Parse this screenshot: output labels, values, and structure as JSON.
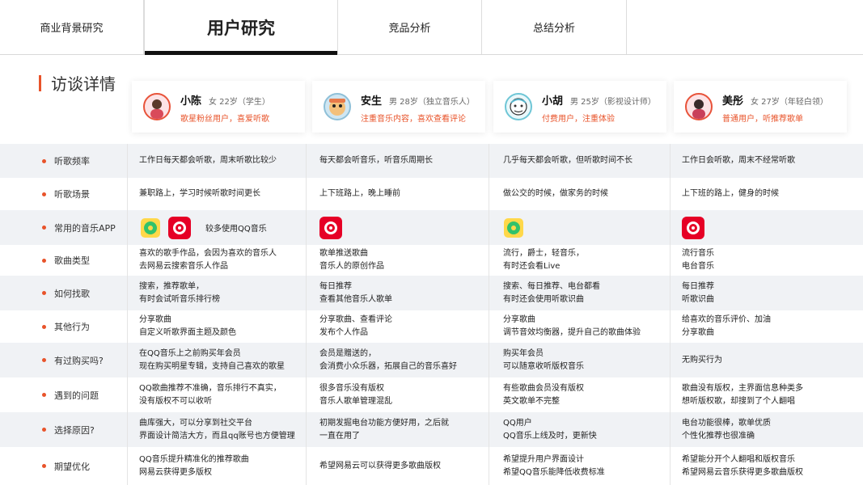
{
  "tabs": [
    {
      "label": "商业背景研究"
    },
    {
      "label": "用户研究"
    },
    {
      "label": "竞品分析"
    },
    {
      "label": "总结分析"
    }
  ],
  "section_title": "访谈详情",
  "users": [
    {
      "name": "小陈",
      "meta": "女 22岁（学生）",
      "tags": "歌星粉丝用户，喜爱听歌"
    },
    {
      "name": "安生",
      "meta": "男 28岁（独立音乐人）",
      "tags": "注重音乐内容，喜欢查看评论"
    },
    {
      "name": "小胡",
      "meta": "男 25岁（影视设计师）",
      "tags": "付费用户，注重体验"
    },
    {
      "name": "美彤",
      "meta": "女 27岁（年轻白领）",
      "tags": "普通用户，听推荐歌单"
    }
  ],
  "rows": [
    {
      "label": "听歌频率",
      "cells": [
        [
          "工作日每天都会听歌，周末听歌比较少"
        ],
        [
          "每天都会听音乐，听音乐周期长"
        ],
        [
          "几乎每天都会听歌，但听歌时间不长"
        ],
        [
          "工作日会听歌，周末不经常听歌"
        ]
      ]
    },
    {
      "label": "听歌场景",
      "cells": [
        [
          "兼职路上，学习时候听歌时间更长"
        ],
        [
          "上下班路上，晚上睡前"
        ],
        [
          "做公交的时候，做家务的时候"
        ],
        [
          "上下班的路上，健身的时候"
        ]
      ]
    },
    {
      "label": "常用的音乐APP",
      "app_note": "较多使用QQ音乐"
    },
    {
      "label": "歌曲类型",
      "cells": [
        [
          "喜欢的歌手作品，会因为喜欢的音乐人",
          "去网易云搜索音乐人作品"
        ],
        [
          "歌单推送歌曲",
          "音乐人的原创作品"
        ],
        [
          "流行，爵士，轻音乐，",
          "有时还会看Live"
        ],
        [
          "流行音乐",
          "电台音乐"
        ]
      ]
    },
    {
      "label": "如何找歌",
      "cells": [
        [
          "搜索，推荐歌单，",
          "有时会试听音乐排行榜"
        ],
        [
          "每日推荐",
          "查看其他音乐人歌单"
        ],
        [
          "搜索、每日推荐、电台都看",
          "有时还会使用听歌识曲"
        ],
        [
          "每日推荐",
          "听歌识曲"
        ]
      ]
    },
    {
      "label": "其他行为",
      "cells": [
        [
          "分享歌曲",
          "自定义听歌界面主题及颜色"
        ],
        [
          "分享歌曲、查看评论",
          "发布个人作品"
        ],
        [
          "分享歌曲",
          "调节音效均衡器，提升自己的歌曲体验"
        ],
        [
          "给喜欢的音乐评价、加油",
          "分享歌曲"
        ]
      ]
    },
    {
      "label": "有过购买吗?",
      "cells": [
        [
          "在QQ音乐上之前购买年会员",
          "现在购买明星专辑，支持自己喜欢的歌星"
        ],
        [
          "会员是赠送的，",
          "会消费小众乐器，拓展自己的音乐喜好"
        ],
        [
          "购买年会员",
          "可以随意收听版权音乐"
        ],
        [
          "无购买行为"
        ]
      ]
    },
    {
      "label": "遇到的问题",
      "cells": [
        [
          "QQ歌曲推荐不准确，音乐排行不真实，",
          "没有版权不可以收听"
        ],
        [
          "很多音乐没有版权",
          "音乐人歌单管理混乱"
        ],
        [
          "有些歌曲会员没有版权",
          "英文歌单不完整"
        ],
        [
          "歌曲没有版权，主界面信息种类多",
          "想听版权歌，却搜到了个人翻唱"
        ]
      ]
    },
    {
      "label": "选择原因?",
      "cells": [
        [
          "曲库强大，可以分享到社交平台",
          "界面设计简洁大方，而且qq账号也方便管理"
        ],
        [
          "初期发掘电台功能方便好用，之后就",
          "一直在用了"
        ],
        [
          "QQ用户",
          "QQ音乐上线及时，更新快"
        ],
        [
          "电台功能很棒，歌单优质",
          "个性化推荐也很准确"
        ]
      ]
    },
    {
      "label": "期望优化",
      "cells": [
        [
          "QQ音乐提升精准化的推荐歌曲",
          "网易云获得更多版权"
        ],
        [
          "希望网易云可以获得更多歌曲版权"
        ],
        [
          "希望提升用户界面设计",
          "希望QQ音乐能降低收费标准"
        ],
        [
          "希望能分开个人翻唱和版权音乐",
          "希望网易云音乐获得更多歌曲版权"
        ]
      ]
    }
  ],
  "colors": {
    "accent": "#e8532a",
    "row_shade": "#f0f2f5",
    "netease_red": "#e60026",
    "qq_yellow": "#ffd84a",
    "qq_green": "#32c26b"
  }
}
